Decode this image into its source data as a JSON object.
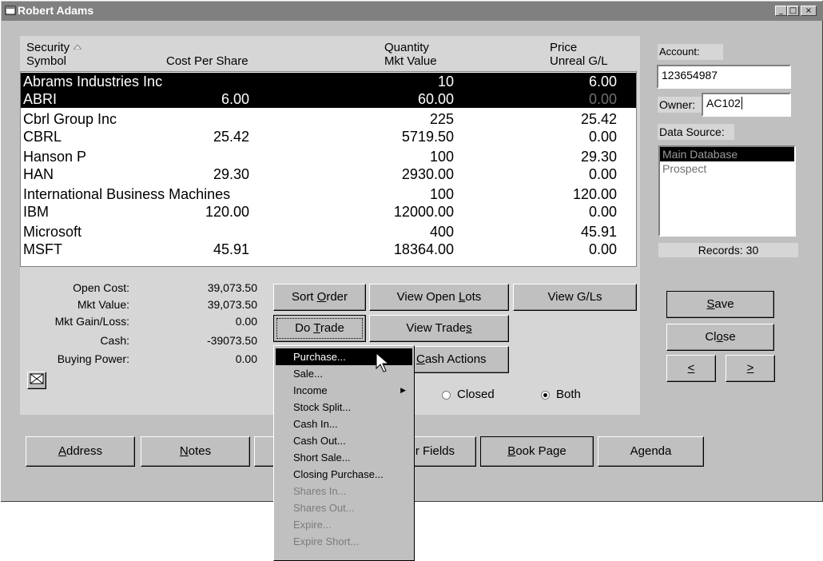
{
  "window": {
    "title": "Robert Adams",
    "controls": [
      "_",
      "□",
      "×"
    ]
  },
  "grid": {
    "headers": {
      "security": "Security",
      "symbol": "Symbol",
      "cost_per_share": "Cost Per Share",
      "quantity": "Quantity",
      "mkt_value": "Mkt Value",
      "price": "Price",
      "unreal_gl": "Unreal G/L"
    },
    "rows": [
      {
        "name": "Abrams Industries Inc",
        "symbol": "ABRI",
        "cost": "6.00",
        "qty": "10",
        "mkt": "60.00",
        "price": "6.00",
        "ugl": "0.00",
        "selected": true
      },
      {
        "name": "Cbrl Group Inc",
        "symbol": "CBRL",
        "cost": "25.42",
        "qty": "225",
        "mkt": "5719.50",
        "price": "25.42",
        "ugl": "0.00"
      },
      {
        "name": "Hanson P",
        "symbol": "HAN",
        "cost": "29.30",
        "qty": "100",
        "mkt": "2930.00",
        "price": "29.30",
        "ugl": "0.00"
      },
      {
        "name": "International Business Machines",
        "symbol": "IBM",
        "cost": "120.00",
        "qty": "100",
        "mkt": "12000.00",
        "price": "120.00",
        "ugl": "0.00"
      },
      {
        "name": "Microsoft",
        "symbol": "MSFT",
        "cost": "45.91",
        "qty": "400",
        "mkt": "18364.00",
        "price": "45.91",
        "ugl": "0.00"
      }
    ]
  },
  "summary": {
    "open_cost_label": "Open Cost:",
    "open_cost": "39,073.50",
    "mkt_value_label": "Mkt Value:",
    "mkt_value": "39,073.50",
    "mkt_gain_label": "Mkt Gain/Loss:",
    "mkt_gain": "0.00",
    "cash_label": "Cash:",
    "cash": "-39073.50",
    "buying_power_label": "Buying Power:",
    "buying_power": "0.00"
  },
  "buttons": {
    "sort_order_pre": "Sort ",
    "sort_order_u": "O",
    "sort_order_post": "rder",
    "view_open_lots_pre": "View Open ",
    "view_open_lots_u": "L",
    "view_open_lots_post": "ots",
    "view_gls": "View G/Ls",
    "do_trade_pre": "Do ",
    "do_trade_u": "T",
    "do_trade_post": "rade",
    "view_trades_pre": "View Trade",
    "view_trades_u": "s",
    "view_trades_post": "",
    "cash_actions_u": "C",
    "cash_actions_post": "ash Actions",
    "save_u": "S",
    "save_post": "ave",
    "close_pre": "Cl",
    "close_u": "o",
    "close_post": "se",
    "prev": "<",
    "next": ">",
    "address_u": "A",
    "address_post": "ddress",
    "notes_u": "N",
    "notes_post": "otes",
    "fields_partial": "r Fields",
    "book_page_u": "B",
    "book_page_post": "ook Page",
    "agenda_pre": "A",
    "agenda_u": "g",
    "agenda_post": "enda"
  },
  "radios": {
    "closed": "Closed",
    "both": "Both",
    "selected": "both"
  },
  "right": {
    "account_label": "Account:",
    "account_value": "123654987",
    "owner_label": "Owner:",
    "owner_value": "AC102",
    "data_source_label": "Data Source:",
    "data_sources": [
      "Main Database",
      "Prospect"
    ],
    "records": "Records: 30"
  },
  "menu": {
    "items": [
      {
        "label": "Purchase...",
        "state": "highlighted"
      },
      {
        "label": "Sale...",
        "state": "enabled"
      },
      {
        "label": "Income",
        "state": "enabled",
        "submenu": true
      },
      {
        "label": "Stock Split...",
        "state": "enabled"
      },
      {
        "label": "Cash In...",
        "state": "enabled"
      },
      {
        "label": "Cash Out...",
        "state": "enabled"
      },
      {
        "label": "Short Sale...",
        "state": "enabled"
      },
      {
        "label": "Closing Purchase...",
        "state": "enabled"
      },
      {
        "label": "Shares In...",
        "state": "disabled"
      },
      {
        "label": "Shares Out...",
        "state": "disabled"
      },
      {
        "label": "Expire...",
        "state": "disabled"
      },
      {
        "label": "Expire Short...",
        "state": "disabled"
      }
    ]
  }
}
